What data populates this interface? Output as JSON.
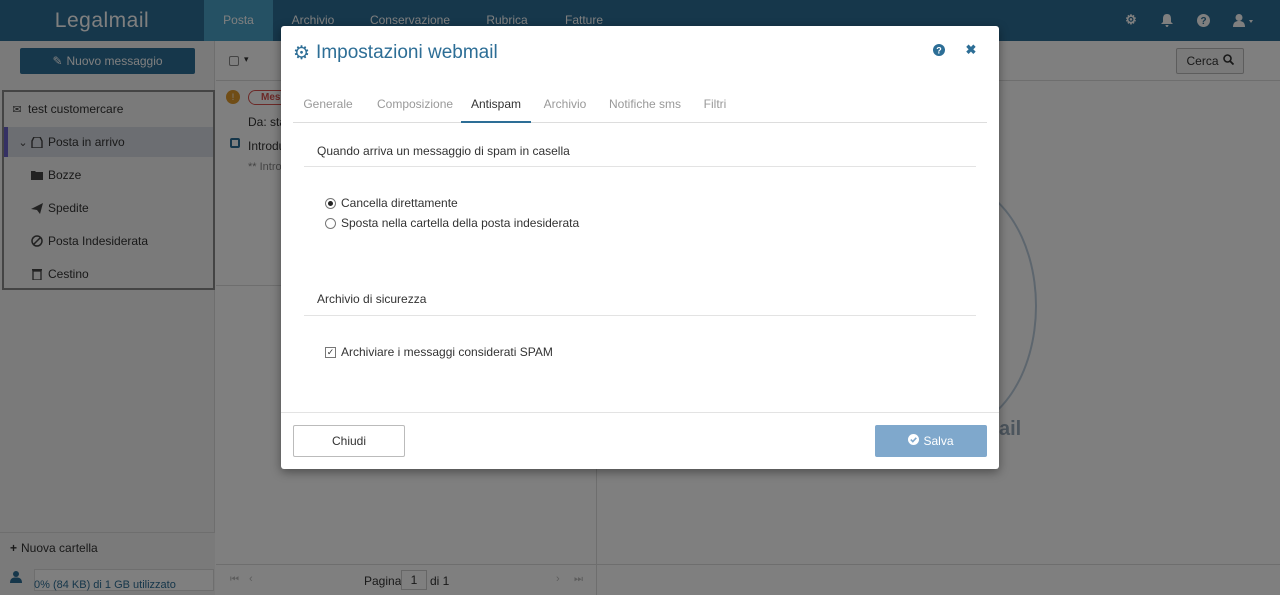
{
  "app": {
    "logo_text": "Legalmail",
    "nav": [
      "Posta",
      "Archivio",
      "Conservazione",
      "Rubrica",
      "Fatture"
    ]
  },
  "sidebar": {
    "new_message_label": "Nuovo messaggio",
    "account": "test customercare",
    "folders": [
      {
        "label": "Posta in arrivo",
        "icon": "inbox-icon"
      },
      {
        "label": "Bozze",
        "icon": "folder-icon"
      },
      {
        "label": "Spedite",
        "icon": "send-icon"
      },
      {
        "label": "Posta Indesiderata",
        "icon": "ban-icon"
      },
      {
        "label": "Cestino",
        "icon": "trash-icon"
      }
    ],
    "new_folder_label": "Nuova cartella",
    "quota_text": "0% (84 KB) di 1 GB utilizzato"
  },
  "list": {
    "badge_text": "Mes",
    "from_prefix": "Da: sta",
    "subject_partial": "Introdu",
    "preview_partial": "** Intro",
    "pagination": {
      "label": "Pagina",
      "current": "1",
      "of_label": "di 1"
    }
  },
  "preview": {
    "search_label": "Cerca",
    "watermark_text": "ail"
  },
  "modal": {
    "title": "Impostazioni webmail",
    "tabs": [
      "Generale",
      "Composizione",
      "Antispam",
      "Archivio",
      "Notifiche sms",
      "Filtri"
    ],
    "active_tab": "Antispam",
    "spam_section_title": "Quando arriva un messaggio di spam in casella",
    "spam_options": [
      {
        "label": "Cancella direttamente",
        "selected": true
      },
      {
        "label": "Sposta nella cartella della posta indesiderata",
        "selected": false
      }
    ],
    "archive_section_title": "Archivio di sicurezza",
    "archive_checkbox_label": "Archiviare i messaggi considerati SPAM",
    "archive_checked": true,
    "close_label": "Chiudi",
    "save_label": "Salva"
  },
  "colors": {
    "brand": "#2d6e96",
    "nav_active": "#4aa3c9",
    "save_disabled": "#7fa8cc"
  }
}
